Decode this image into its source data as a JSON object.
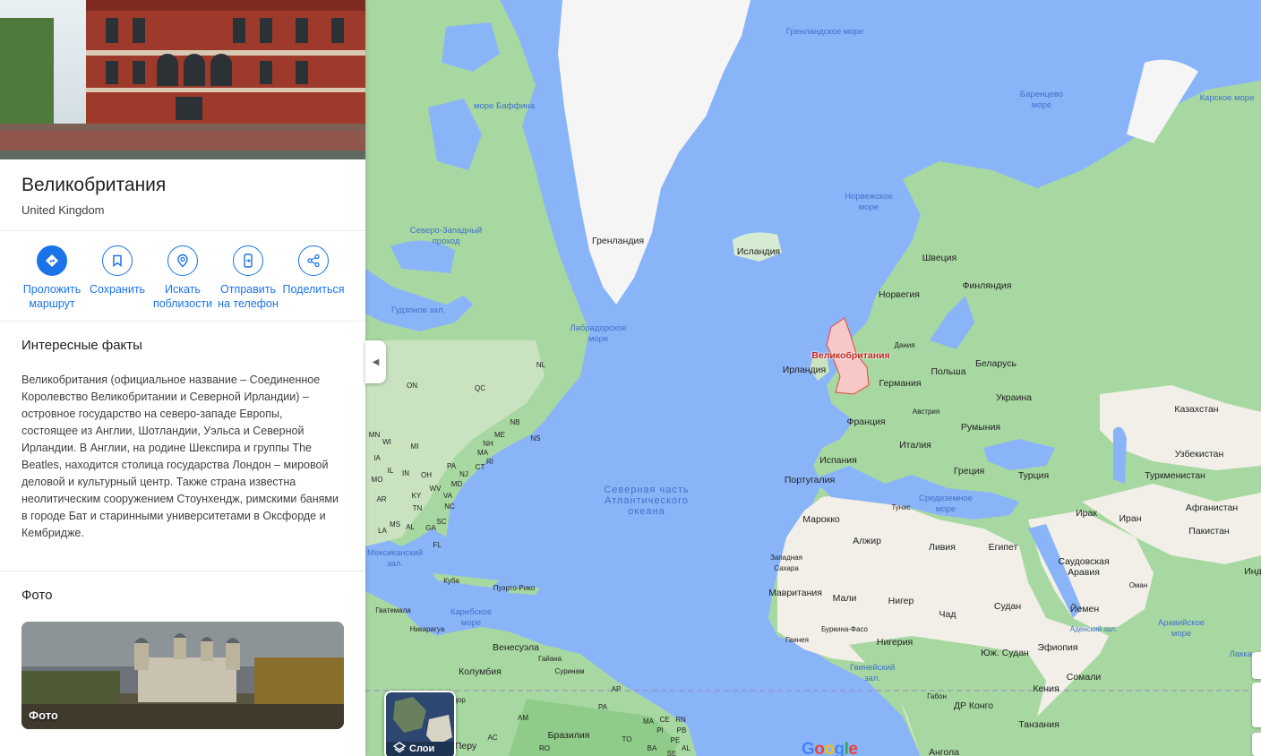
{
  "place": {
    "title": "Великобритания",
    "subtitle": "United Kingdom"
  },
  "actions": [
    {
      "label": "Проложить маршрут",
      "icon": "directions-icon"
    },
    {
      "label": "Сохранить",
      "icon": "bookmark-icon"
    },
    {
      "label": "Искать поблизости",
      "icon": "nearby-icon"
    },
    {
      "label": "Отправить на телефон",
      "icon": "phone-icon"
    },
    {
      "label": "Поделиться",
      "icon": "share-icon"
    }
  ],
  "facts": {
    "heading": "Интересные факты",
    "text": "Великобритания (официальное название – Соединенное Королевство Великобритании и Северной Ирландии) – островное государство на северо-западе Европы, состоящее из Англии, Шотландии, Уэльса и Северной Ирландии. В Англии, на родине Шекспира и группы The Beatles, находится столица государства Лондон – мировой деловой и культурный центр. Также страна известна неолитическим сооружением Стоунхендж, римскими банями в городе Бат и старинными университетами в Оксфорде и Кембридже."
  },
  "photos": {
    "heading": "Фото",
    "label": "Фото"
  },
  "map": {
    "layers_label": "Слои",
    "google_logo": "Google",
    "labels": {
      "greenland_sea": "Гренландское море",
      "barents_sea": "Баренцево море",
      "kara_sea": "Карское море",
      "baffin_sea": "море Баффина",
      "norwegian_sea": "Норвежское море",
      "nw_passage": "Северо-Западный проход",
      "greenland": "Гренландия",
      "iceland": "Исландия",
      "sweden": "Швеция",
      "finland": "Финляндия",
      "norway": "Норвегия",
      "hudson_bay": "Гудзонов зал.",
      "labrador_sea": "Лабрадорское море",
      "denmark": "Дания",
      "uk": "Великобритания",
      "ireland": "Ирландия",
      "poland": "Польша",
      "belarus": "Беларусь",
      "germany": "Германия",
      "ukraine": "Украина",
      "kazakhstan": "Казахстан",
      "austria": "Австрия",
      "france": "Франция",
      "romania": "Румыния",
      "italy": "Италия",
      "spain": "Испания",
      "greece": "Греция",
      "turkey": "Турция",
      "uzbekistan": "Узбекистан",
      "turkmenistan": "Туркменистан",
      "portugal": "Португалия",
      "n_atlantic": "Северная часть Атлантического океана",
      "mediterranean": "Средиземное море",
      "tunisia": "Тунис",
      "morocco": "Марокко",
      "algeria": "Алжир",
      "libya": "Ливия",
      "egypt": "Египет",
      "iraq": "Ирак",
      "iran": "Иран",
      "afghanistan": "Афганистан",
      "pakistan": "Пакистан",
      "w_sahara": "Западная Сахара",
      "saudi": "Саудовская Аравия",
      "oman": "Оман",
      "india": "Инд",
      "mexican_gulf": "Мексиканский зал.",
      "cuba": "Куба",
      "puerto_rico": "Пуэрто-Рико",
      "mauritania": "Мавритания",
      "mali": "Мали",
      "niger": "Нигер",
      "chad": "Чад",
      "sudan": "Судан",
      "yemen": "Йемен",
      "guatemala": "Гватемала",
      "caribbean": "Карибское море",
      "nicaragua": "Никарагуа",
      "aden": "Аденский зал.",
      "arabian_sea": "Аравийское море",
      "guinea": "Гвинея",
      "burkina": "Буркина-Фасо",
      "nigeria": "Нигерия",
      "s_sudan": "Юж. Судан",
      "ethiopia": "Эфиопия",
      "venezuela": "Венесуэла",
      "guyana": "Гайана",
      "suriname": "Суринам",
      "colombia": "Колумбия",
      "lakkad": "Лаккад",
      "guinea_gulf": "Гвинейский зал.",
      "somalia": "Сомали",
      "kenya": "Кения",
      "gabon": "Габон",
      "drc": "ДР Конго",
      "ecuador": "дор",
      "brazil": "Бразилия",
      "peru": "Перу",
      "tanzania": "Танзания",
      "angola": "Ангола",
      "ontario": "ON",
      "quebec": "QC",
      "newfoundland": "NL",
      "new_brunswick": "NB",
      "nova_scotia": "NS",
      "maine": "ME",
      "new_hampshire": "NH",
      "massachusetts": "MA",
      "rhode_island": "RI",
      "connecticut": "CT",
      "new_jersey": "NJ",
      "pennsylvania": "PA",
      "ohio": "OH",
      "maryland": "MD",
      "west_virginia": "WV",
      "virginia": "VA",
      "kentucky": "KY",
      "north_carolina": "NC",
      "tennessee": "TN",
      "south_carolina": "SC",
      "georgia_us": "GA",
      "alabama": "AL",
      "mississippi": "MS",
      "arkansas": "AR",
      "missouri": "MO",
      "illinois": "IL",
      "indiana": "IN",
      "iowa": "IA",
      "wisconsin": "WI",
      "michigan": "MI",
      "minnesota": "MN",
      "florida": "FL",
      "louisiana": "LA",
      "amapa": "AP",
      "para": "PA",
      "maranhao": "MA",
      "ceara": "CE",
      "rio_grande_norte": "RN",
      "paraiba": "PB",
      "piaui": "PI",
      "pernambuco": "PE",
      "amazonas": "AM",
      "acre": "AC",
      "rondonia": "RO",
      "tocantins": "TO",
      "bahia": "BA",
      "alagoas": "AL",
      "sergipe": "SE"
    }
  }
}
